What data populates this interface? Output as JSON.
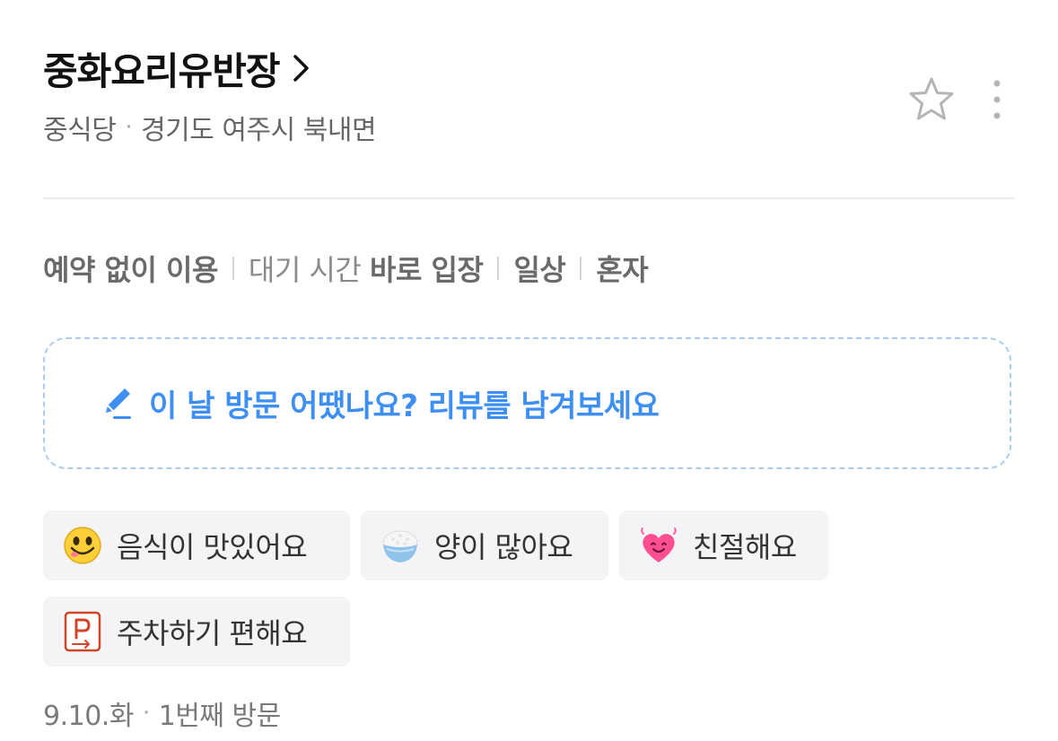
{
  "header": {
    "title": "중화요리유반장",
    "category": "중식당",
    "location": "경기도 여주시 북내면",
    "separator": "·"
  },
  "icons": {
    "title_chevron": "chevron-right-icon",
    "favorite": "star-outline-icon",
    "more": "more-vertical-icon",
    "edit": "pencil-icon"
  },
  "visit_tags": [
    {
      "prefix": "",
      "value": "예약 없이 이용"
    },
    {
      "prefix": "대기 시간 ",
      "value": "바로 입장"
    },
    {
      "prefix": "",
      "value": "일상"
    },
    {
      "prefix": "",
      "value": "혼자"
    }
  ],
  "review_prompt": {
    "text": "이 날 방문 어땠나요? 리뷰를 남겨보세요"
  },
  "keywords": [
    {
      "label": "음식이 맛있어요",
      "icon": "yummy-face-emoji-icon"
    },
    {
      "label": "양이 많아요",
      "icon": "rice-bowl-emoji-icon"
    },
    {
      "label": "친절해요",
      "icon": "smiling-heart-emoji-icon"
    },
    {
      "label": "주차하기 편해요",
      "icon": "parking-sign-icon"
    }
  ],
  "footer": {
    "date": "9.10.화",
    "separator": "·",
    "visit_count": "1번째 방문"
  },
  "colors": {
    "accent_blue": "#3d8ff3",
    "dashed_border": "#a9cdf2",
    "chip_bg": "#f4f4f6"
  }
}
